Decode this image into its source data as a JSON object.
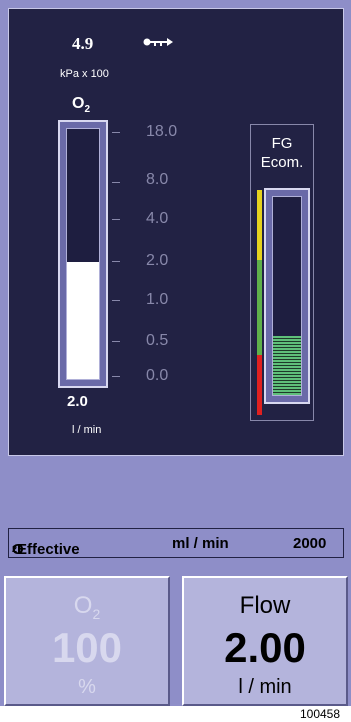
{
  "display": {
    "pressure": {
      "value": "4.9",
      "unit": "kPa x 100"
    },
    "o2_flow_bar": {
      "label": "O",
      "label_sub": "2",
      "fill_fraction": 0.47,
      "value": "2.0",
      "unit": "l / min",
      "scale": [
        "18.0",
        "8.0",
        "4.0",
        "2.0",
        "1.0",
        "0.5",
        "0.0"
      ]
    },
    "ecom_bar": {
      "label_line1": "FG",
      "label_line2": "Ecom.",
      "fill_fraction": 0.3,
      "colors": {
        "high": "#e6d21e",
        "ok": "#5fb04a",
        "low": "#e02020"
      }
    }
  },
  "status_row": {
    "label": "O",
    "label_sub": "2",
    "label_rest": "Effective",
    "unit": "ml / min",
    "value": "2000"
  },
  "buttons": {
    "o2": {
      "label": "O",
      "label_sub": "2",
      "value": "100",
      "unit": "%"
    },
    "flow": {
      "label": "Flow",
      "value": "2.00",
      "unit": "l / min"
    }
  },
  "figure_ref": "100458"
}
